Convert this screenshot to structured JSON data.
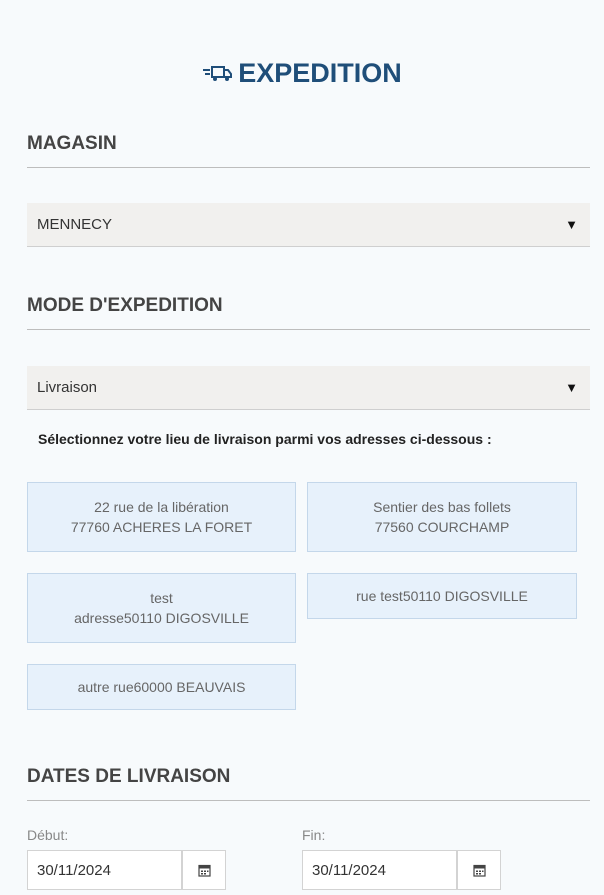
{
  "title": "EXPEDITION",
  "magasin": {
    "heading": "MAGASIN",
    "selected": "MENNECY"
  },
  "mode": {
    "heading": "MODE D'EXPEDITION",
    "selected": "Livraison"
  },
  "instruction": "Sélectionnez votre lieu de livraison parmi vos adresses ci-dessous :",
  "addresses": [
    {
      "line1": "22 rue de la libération",
      "line2": "77760 ACHERES LA FORET"
    },
    {
      "line1": "Sentier des bas follets",
      "line2": "77560 COURCHAMP"
    },
    {
      "line1": "test",
      "line2": "adresse50110 DIGOSVILLE"
    },
    {
      "line1": "rue test50110 DIGOSVILLE",
      "line2": ""
    },
    {
      "line1": "autre rue60000 BEAUVAIS",
      "line2": ""
    }
  ],
  "dates": {
    "heading": "DATES DE LIVRAISON",
    "start_label": "Début:",
    "start_value": "30/11/2024",
    "end_label": "Fin:",
    "end_value": "30/11/2024"
  },
  "icons": {
    "title_icon": "truck-icon",
    "calendar": "calendar-icon",
    "dropdown": "triangle-down-icon"
  },
  "colors": {
    "title": "#1f4e79",
    "address_bg": "#e7f1fb",
    "address_border": "#c4d7ea"
  }
}
